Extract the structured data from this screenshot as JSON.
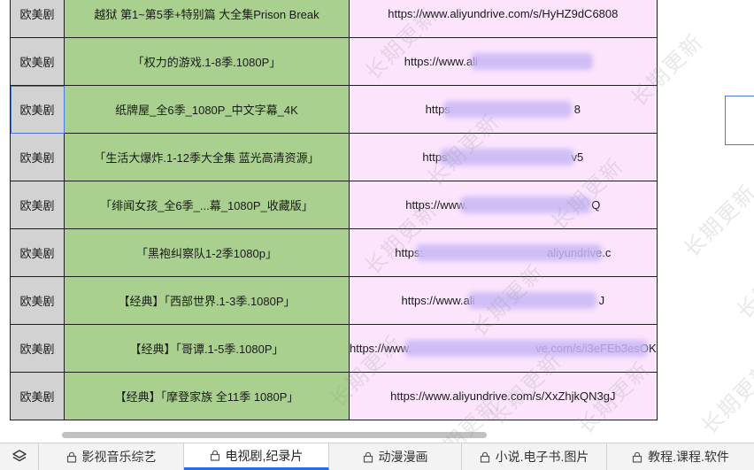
{
  "watermark_text": "长期更新",
  "rows": [
    {
      "category": "欧美剧",
      "title": "越狱 第1~第5季+特别篇 大全集Prison Break",
      "link_prefix": "https://www.aliyundrive.com/s/",
      "link_suffix": "HyHZ9dC6808",
      "blurred": false
    },
    {
      "category": "欧美剧",
      "title": "「权力的游戏.1-8季.1080P」",
      "link_prefix": "https://www.ali",
      "link_suffix": "",
      "blurred": true
    },
    {
      "category": "欧美剧",
      "title": "纸牌屋_全6季_1080P_中文字幕_4K",
      "link_prefix": "https",
      "link_suffix": "8",
      "blurred": true
    },
    {
      "category": "欧美剧",
      "title": "「生活大爆炸.1-12季大全集 蓝光高清资源」",
      "link_prefix": "https",
      "link_suffix": "v5",
      "blurred": true
    },
    {
      "category": "欧美剧",
      "title": "「绯闻女孩_全6季_...幕_1080P_收藏版」",
      "link_prefix": "https://www.",
      "link_suffix": "Q",
      "blurred": true
    },
    {
      "category": "欧美剧",
      "title": "「黑袍纠察队1-2季1080p」",
      "link_prefix": "https:",
      "link_suffix": "aliyundrive.c",
      "blurred": true
    },
    {
      "category": "欧美剧",
      "title": "【经典】「西部世界.1-3季.1080P」",
      "link_prefix": "https://www.ali",
      "link_suffix": "J",
      "blurred": true
    },
    {
      "category": "欧美剧",
      "title": "【经典】「哥谭.1-5季.1080P」",
      "link_prefix": "https://www.",
      "link_suffix": "ve.com/s/i3eFEb3esOK",
      "blurred": true
    },
    {
      "category": "欧美剧",
      "title": "【经典】「摩登家族 全11季 1080P」",
      "link_prefix": "https://www.aliyundrive.com/s/XxZhjkQN3gJ",
      "link_suffix": "",
      "blurred": false
    }
  ],
  "tabs": [
    {
      "label": "影视音乐综艺",
      "active": false
    },
    {
      "label": "电视剧,纪录片",
      "active": true
    },
    {
      "label": "动漫漫画",
      "active": false
    },
    {
      "label": "小说.电子书.图片",
      "active": false
    },
    {
      "label": "教程.课程.软件",
      "active": false
    }
  ],
  "colors": {
    "category_fill": "#d2d2d2",
    "title_fill": "#a9d08e",
    "link_fill": "#fce4fd",
    "link_text": "#1a1ae0",
    "active_tab_accent": "#2b6de0"
  }
}
